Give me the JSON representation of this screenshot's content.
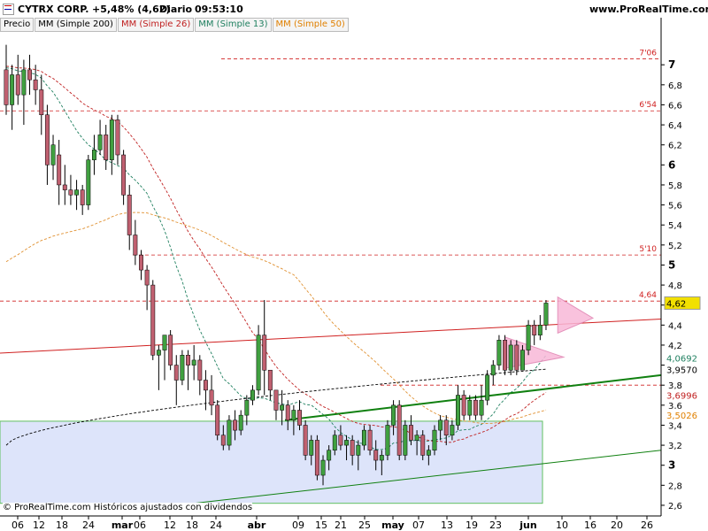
{
  "header": {
    "symbol": "CYTRX CORP.",
    "change": "+5,48% (4,62)",
    "period": "Diario",
    "time": "09:53:10",
    "site": "www.ProRealTime.com"
  },
  "tabs": [
    {
      "label": "Precio",
      "color": "#000000"
    },
    {
      "label": "MM (Simple 200)",
      "color": "#000000"
    },
    {
      "label": "MM (Simple 26)",
      "color": "#c02020"
    },
    {
      "label": "MM (Simple 13)",
      "color": "#208060"
    },
    {
      "label": "MM (Simple 50)",
      "color": "#e08000"
    }
  ],
  "footer": "© ProRealTime.com Históricos ajustados con dividendos",
  "colors": {
    "up": "#40a040",
    "down": "#c06070",
    "ma200": "#000000",
    "ma26": "#c02020",
    "ma13": "#208060",
    "ma50": "#e09030",
    "resistance": "#d02020",
    "channel": "#108010",
    "triangle": "#f8b8d8",
    "box": "#dde4fa"
  },
  "chart_data": {
    "type": "candlestick",
    "ylim": [
      2.55,
      7.3
    ],
    "y_ticks": [
      "2,6",
      "2,8",
      "3",
      "3,2",
      "3,4",
      "3,6",
      "3,8",
      "4",
      "4,2",
      "4,4",
      "4,6",
      "4,8",
      "5",
      "5,2",
      "5,4",
      "5,6",
      "5,8",
      "6",
      "6,2",
      "6,4",
      "6,6",
      "6,8",
      "7"
    ],
    "x_ticks": [
      "06",
      "12",
      "18",
      "24",
      "mar",
      "06",
      "12",
      "18",
      "24",
      "abr",
      "09",
      "15",
      "21",
      "25",
      "may",
      "07",
      "13",
      "19",
      "23",
      "jun",
      "10",
      "16",
      "20",
      "26"
    ],
    "candles": [
      [
        6.95,
        7.2,
        6.5,
        6.6
      ],
      [
        6.6,
        7.0,
        6.35,
        6.9
      ],
      [
        6.9,
        7.1,
        6.6,
        6.7
      ],
      [
        6.7,
        7.05,
        6.4,
        6.95
      ],
      [
        6.95,
        7.1,
        6.7,
        6.85
      ],
      [
        6.85,
        7.0,
        6.6,
        6.75
      ],
      [
        6.75,
        6.9,
        6.3,
        6.5
      ],
      [
        6.5,
        6.6,
        5.8,
        6.0
      ],
      [
        6.0,
        6.3,
        5.85,
        6.2
      ],
      [
        6.1,
        6.25,
        5.6,
        5.8
      ],
      [
        5.8,
        6.0,
        5.6,
        5.75
      ],
      [
        5.75,
        5.9,
        5.6,
        5.7
      ],
      [
        5.7,
        5.85,
        5.55,
        5.75
      ],
      [
        5.75,
        5.8,
        5.5,
        5.6
      ],
      [
        5.6,
        6.1,
        5.55,
        6.05
      ],
      [
        6.05,
        6.3,
        5.9,
        6.15
      ],
      [
        6.15,
        6.45,
        6.1,
        6.3
      ],
      [
        6.3,
        6.4,
        5.95,
        6.05
      ],
      [
        6.05,
        6.5,
        5.9,
        6.45
      ],
      [
        6.45,
        6.5,
        6.0,
        6.1
      ],
      [
        6.1,
        6.15,
        5.6,
        5.7
      ],
      [
        5.7,
        5.8,
        5.15,
        5.3
      ],
      [
        5.3,
        5.45,
        5.0,
        5.1
      ],
      [
        5.1,
        5.15,
        4.85,
        4.95
      ],
      [
        4.95,
        5.0,
        4.55,
        4.8
      ],
      [
        4.8,
        4.85,
        4.05,
        4.1
      ],
      [
        4.1,
        4.2,
        3.75,
        4.15
      ],
      [
        4.15,
        4.3,
        3.85,
        4.3
      ],
      [
        4.3,
        4.35,
        3.95,
        4.0
      ],
      [
        4.0,
        4.1,
        3.6,
        3.85
      ],
      [
        3.85,
        4.15,
        3.8,
        4.1
      ],
      [
        4.1,
        4.15,
        3.75,
        4.0
      ],
      [
        4.0,
        4.2,
        3.85,
        4.05
      ],
      [
        4.05,
        4.1,
        3.7,
        3.85
      ],
      [
        3.85,
        3.95,
        3.55,
        3.75
      ],
      [
        3.75,
        3.9,
        3.5,
        3.6
      ],
      [
        3.6,
        3.65,
        3.25,
        3.3
      ],
      [
        3.3,
        3.4,
        3.15,
        3.2
      ],
      [
        3.2,
        3.5,
        3.15,
        3.45
      ],
      [
        3.45,
        3.55,
        3.25,
        3.35
      ],
      [
        3.35,
        3.55,
        3.3,
        3.5
      ],
      [
        3.5,
        3.7,
        3.4,
        3.65
      ],
      [
        3.65,
        3.8,
        3.6,
        3.75
      ],
      [
        3.75,
        4.4,
        3.7,
        4.3
      ],
      [
        4.3,
        4.65,
        3.7,
        3.95
      ],
      [
        3.95,
        3.95,
        3.65,
        3.75
      ],
      [
        3.75,
        3.75,
        3.45,
        3.55
      ],
      [
        3.55,
        3.75,
        3.4,
        3.6
      ],
      [
        3.6,
        3.65,
        3.35,
        3.45
      ],
      [
        3.45,
        3.6,
        3.3,
        3.55
      ],
      [
        3.55,
        3.65,
        3.35,
        3.4
      ],
      [
        3.4,
        3.45,
        3.05,
        3.1
      ],
      [
        3.1,
        3.3,
        3.0,
        3.25
      ],
      [
        3.25,
        3.3,
        2.85,
        2.9
      ],
      [
        2.9,
        3.1,
        2.8,
        3.05
      ],
      [
        3.05,
        3.2,
        2.95,
        3.15
      ],
      [
        3.15,
        3.35,
        3.1,
        3.3
      ],
      [
        3.3,
        3.4,
        3.15,
        3.2
      ],
      [
        3.2,
        3.3,
        3.05,
        3.25
      ],
      [
        3.25,
        3.3,
        3.0,
        3.1
      ],
      [
        3.1,
        3.25,
        2.95,
        3.2
      ],
      [
        3.2,
        3.4,
        3.15,
        3.35
      ],
      [
        3.35,
        3.4,
        3.1,
        3.15
      ],
      [
        3.15,
        3.25,
        2.95,
        3.05
      ],
      [
        3.05,
        3.15,
        2.9,
        3.1
      ],
      [
        3.1,
        3.45,
        3.05,
        3.4
      ],
      [
        3.4,
        3.65,
        3.3,
        3.6
      ],
      [
        3.6,
        3.65,
        3.05,
        3.1
      ],
      [
        3.1,
        3.45,
        3.05,
        3.4
      ],
      [
        3.4,
        3.5,
        3.2,
        3.25
      ],
      [
        3.25,
        3.35,
        3.1,
        3.3
      ],
      [
        3.3,
        3.35,
        3.05,
        3.1
      ],
      [
        3.1,
        3.2,
        3.0,
        3.15
      ],
      [
        3.15,
        3.4,
        3.1,
        3.35
      ],
      [
        3.35,
        3.5,
        3.25,
        3.45
      ],
      [
        3.45,
        3.5,
        3.2,
        3.3
      ],
      [
        3.3,
        3.45,
        3.25,
        3.4
      ],
      [
        3.4,
        3.8,
        3.35,
        3.7
      ],
      [
        3.7,
        3.75,
        3.45,
        3.5
      ],
      [
        3.5,
        3.7,
        3.45,
        3.65
      ],
      [
        3.65,
        3.7,
        3.45,
        3.5
      ],
      [
        3.5,
        3.8,
        3.45,
        3.65
      ],
      [
        3.65,
        3.95,
        3.6,
        3.9
      ],
      [
        3.9,
        4.05,
        3.8,
        4.0
      ],
      [
        4.0,
        4.3,
        3.95,
        4.25
      ],
      [
        4.25,
        4.3,
        3.9,
        3.95
      ],
      [
        3.95,
        4.25,
        3.9,
        4.2
      ],
      [
        4.2,
        4.25,
        3.9,
        3.95
      ],
      [
        3.95,
        4.2,
        3.95,
        4.15
      ],
      [
        4.15,
        4.45,
        4.1,
        4.4
      ],
      [
        4.4,
        4.45,
        4.2,
        4.3
      ],
      [
        4.3,
        4.5,
        4.25,
        4.4
      ],
      [
        4.4,
        4.65,
        4.35,
        4.62
      ]
    ],
    "levels": [
      {
        "label": "7'06",
        "value": 7.06
      },
      {
        "label": "6'54",
        "value": 6.54
      },
      {
        "label": "5'10",
        "value": 5.1
      },
      {
        "label": "4,64",
        "value": 4.64
      }
    ],
    "value_labels": [
      {
        "label": "4,62",
        "value": 4.62,
        "bg": "#f2e000",
        "fg": "#000000"
      },
      {
        "label": "4,0692",
        "value": 4.0692,
        "bg": "#ffffff",
        "fg": "#208060"
      },
      {
        "label": "3,9570",
        "value": 3.957,
        "bg": "#ffffff",
        "fg": "#000000"
      },
      {
        "label": "3,6996",
        "value": 3.6996,
        "bg": "#ffffff",
        "fg": "#c02020"
      },
      {
        "label": "3,5026",
        "value": 3.5026,
        "bg": "#ffffff",
        "fg": "#e08000"
      }
    ]
  }
}
